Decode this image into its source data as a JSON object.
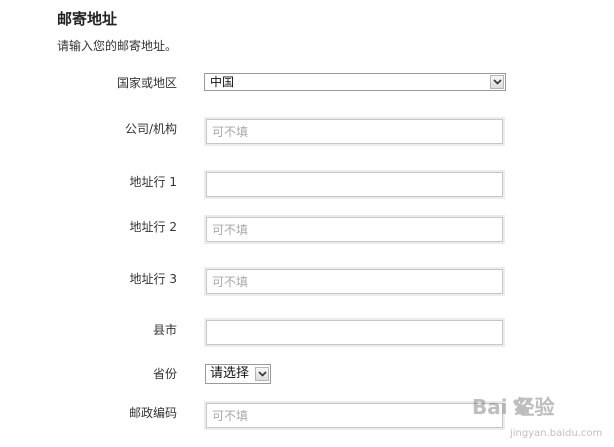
{
  "section": {
    "title": "邮寄地址",
    "description": "请输入您的邮寄地址。"
  },
  "fields": {
    "country": {
      "label": "国家或地区",
      "value": "中国"
    },
    "company": {
      "label": "公司/机构",
      "value": "",
      "placeholder": "可不填"
    },
    "address1": {
      "label": "地址行 1",
      "value": "",
      "placeholder": ""
    },
    "address2": {
      "label": "地址行 2",
      "value": "",
      "placeholder": "可不填"
    },
    "address3": {
      "label": "地址行 3",
      "value": "",
      "placeholder": "可不填"
    },
    "city": {
      "label": "县市",
      "value": "",
      "placeholder": ""
    },
    "province": {
      "label": "省份",
      "value": "请选择"
    },
    "postal": {
      "label": "邮政编码",
      "value": "",
      "placeholder": "可不填"
    }
  },
  "watermark": {
    "brand": "Bai 经验",
    "url": "jingyan.baidu.com"
  },
  "icons": {
    "dropdown": "chevron-down-icon",
    "watermark_logo": "paw-icon"
  }
}
